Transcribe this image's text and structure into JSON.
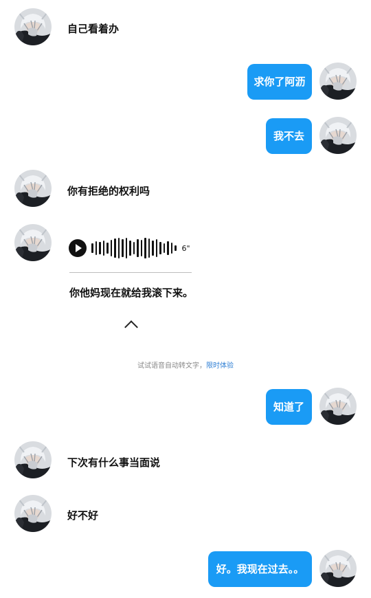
{
  "messages": {
    "m1": "自己看着办",
    "m2": "求你了阿沥",
    "m3": "我不去",
    "m4": "你有拒绝的权利吗",
    "m6": "知道了",
    "m7": "下次有什么事当面说",
    "m8": "好不好",
    "m9": "好。我现在过去。。"
  },
  "voice": {
    "duration": "6\"",
    "transcript": "你他妈现在就给我滚下来。",
    "icon": "play-icon"
  },
  "hint": {
    "text": "试试语音自动转文字，",
    "link": "限时体验"
  },
  "colors": {
    "bubble": "#1a9bf5",
    "link": "#2f7fd4"
  }
}
